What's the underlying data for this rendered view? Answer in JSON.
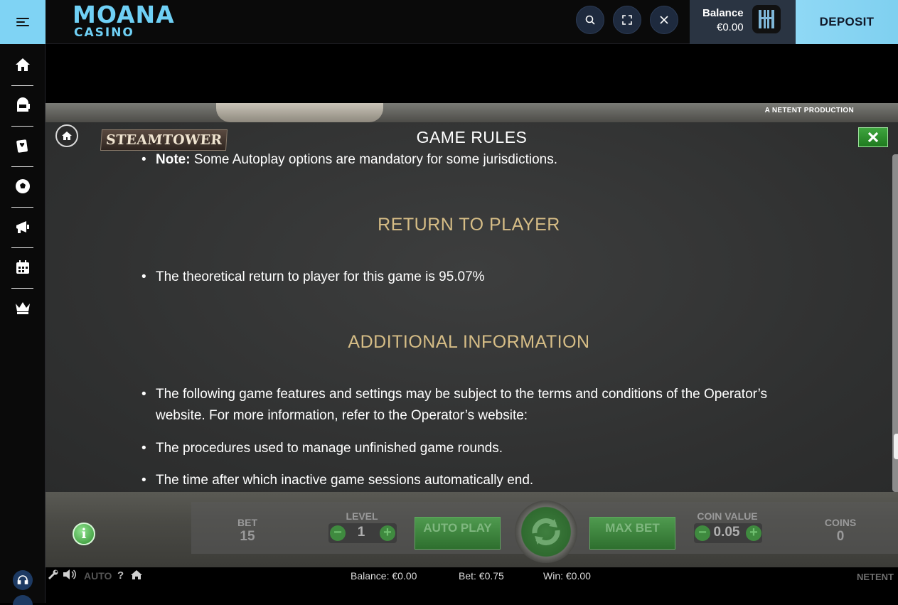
{
  "brand": {
    "logo_line1": "MOANA",
    "logo_line2": "CASINO"
  },
  "header": {
    "balance_label": "Balance",
    "balance_value": "€0.00",
    "deposit_label": "DEPOSIT",
    "search_icon": "search-icon",
    "fullscreen_icon": "fullscreen-icon",
    "close_icon": "close-icon"
  },
  "sidebar": {
    "items": [
      {
        "icon": "home-icon"
      },
      {
        "icon": "slot-machine-icon"
      },
      {
        "icon": "cards-icon"
      },
      {
        "icon": "football-icon"
      },
      {
        "icon": "promotions-icon"
      },
      {
        "icon": "calendar-icon"
      },
      {
        "icon": "crown-icon"
      }
    ],
    "support_icon": "headset-icon"
  },
  "game": {
    "producer": "A NETENT PRODUCTION",
    "logo": "STEAMTOWER",
    "rules": {
      "title": "GAME RULES",
      "note_prefix": "Note:",
      "note_text": " Some Autoplay options are mandatory for some jurisdictions.",
      "rtp_title": "RETURN TO PLAYER",
      "rtp_text": "The theoretical return to player for this game is 95.07%",
      "additional_title": "ADDITIONAL INFORMATION",
      "additional_items": [
        "The following game features and settings may be subject to the terms and conditions of the Operator’s website. For more information, refer to the Operator’s website:",
        "The procedures used to manage unfinished game rounds.",
        "The time after which inactive game sessions automatically end."
      ]
    },
    "controls": {
      "bet_label": "BET",
      "bet_value": "15",
      "level_label": "LEVEL",
      "level_value": "1",
      "autoplay_label": "AUTO PLAY",
      "maxbet_label": "MAX BET",
      "coin_value_label": "COIN VALUE",
      "coin_value": "0.05",
      "coins_label": "COINS",
      "coins_value": "0"
    },
    "status": {
      "auto": "AUTO",
      "help": "?",
      "balance": "Balance: €0.00",
      "bet": "Bet: €0.75",
      "win": "Win: €0.00",
      "netent": "NETENT"
    }
  }
}
